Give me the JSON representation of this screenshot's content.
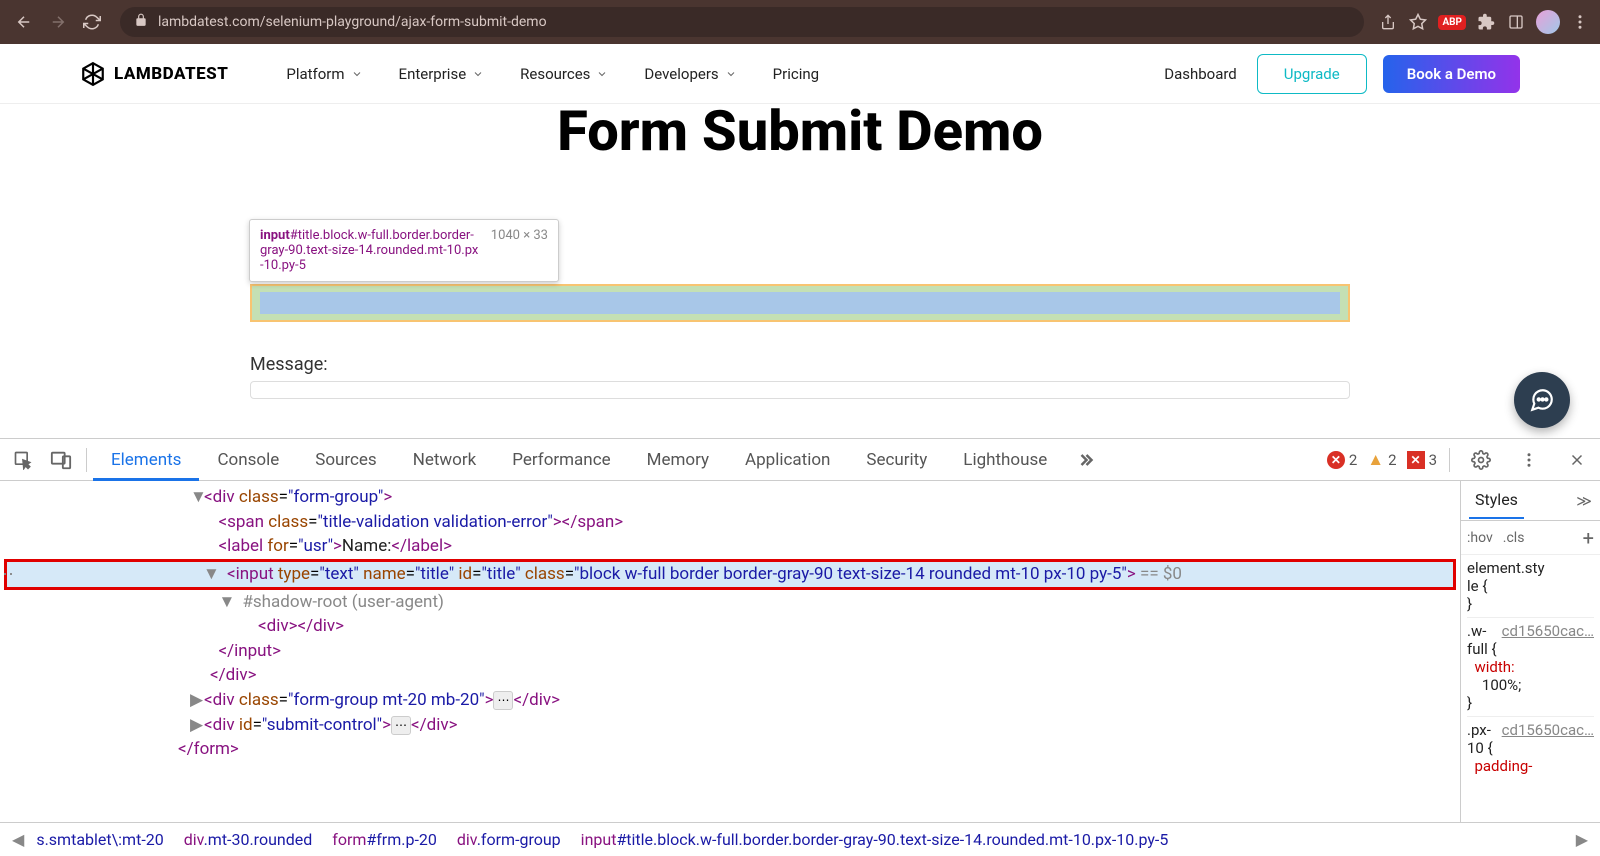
{
  "browser": {
    "url": "lambdatest.com/selenium-playground/ajax-form-submit-demo",
    "abp_label": "ABP"
  },
  "header": {
    "logo": "LAMBDATEST",
    "nav": {
      "platform": "Platform",
      "enterprise": "Enterprise",
      "resources": "Resources",
      "developers": "Developers",
      "pricing": "Pricing"
    },
    "right": {
      "dashboard": "Dashboard",
      "upgrade": "Upgrade",
      "book": "Book a Demo"
    }
  },
  "page": {
    "title": "Form Submit Demo",
    "tooltip_tag": "input",
    "tooltip_selector": "#title.block.w-full.border.border-gray-90.text-size-14.rounded.mt-10.px-10.py-5",
    "tooltip_size": "1040 × 33",
    "message_label": "Message:"
  },
  "devtools": {
    "tabs": {
      "elements": "Elements",
      "console": "Console",
      "sources": "Sources",
      "network": "Network",
      "performance": "Performance",
      "memory": "Memory",
      "application": "Application",
      "security": "Security",
      "lighthouse": "Lighthouse"
    },
    "errors": {
      "red1": "2",
      "yel": "2",
      "red2": "3"
    },
    "dom": {
      "div_open": "<div class=\"form-group\">",
      "span": "<span class=\"title-validation validation-error\"></span>",
      "label": "<label for=\"usr\">Name:</label>",
      "input_line1": "<input type=\"text\" name=\"title\" id=\"title\" class=\"block w-full border border-gray-90 text-size-14 rounded mt-10 px-10 py-5\">",
      "input_eqvar": " == $0",
      "shadow": "#shadow-root (user-agent)",
      "shadow_div": "<div></div>",
      "input_close": "</input>",
      "div_close": "</div>",
      "div2": "<div class=\"form-group mt-20 mb-20\">",
      "div2_close": "</div>",
      "div3": "<div id=\"submit-control\">",
      "div3_close": "</div>",
      "form_close": "</form>"
    },
    "styles": {
      "tab_styles": "Styles",
      "hov": ":hov",
      "cls": ".cls",
      "element_style": "element.style {",
      "brace_close": "}",
      "link1": "cd15650cac…",
      "wfull_sel": ".w-full {",
      "width_prop": "width:",
      "width_val": "100%;",
      "link2": "cd15650cac…",
      "px10_sel": ".px-10 {",
      "padding_prop": "padding-"
    },
    "breadcrumb": {
      "i0": "s.smtablet\\:mt-20",
      "i1": "div.mt-30.rounded",
      "i2_tag": "form",
      "i2_rest": "#frm.p-20",
      "i3": "div.form-group",
      "i4_tag": "input",
      "i4_rest": "#title.block.w-full.border.border-gray-90.text-size-14.rounded.mt-10.px-10.py-5"
    }
  }
}
